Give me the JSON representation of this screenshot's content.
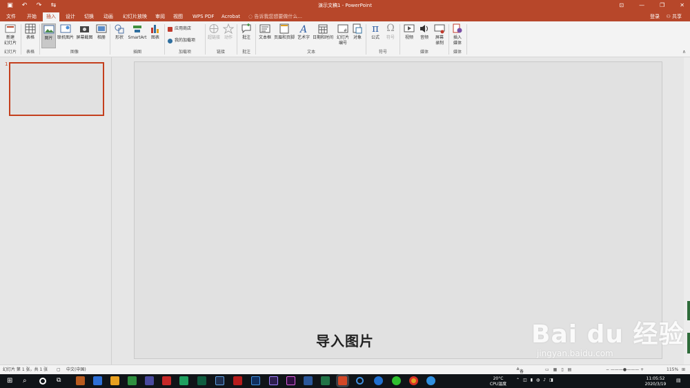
{
  "window": {
    "title": "演示文稿1 - PowerPoint",
    "qat": [
      "save-icon",
      "undo-icon",
      "redo-icon",
      "start-slideshow-icon"
    ],
    "qat_glyphs": [
      "▣",
      "↶",
      "↷",
      "⇆"
    ],
    "controls": [
      "ribbon-display-icon",
      "minimize-icon",
      "restore-icon",
      "close-icon"
    ],
    "control_glyphs": [
      "⊡",
      "—",
      "❐",
      "✕"
    ]
  },
  "menu": {
    "tabs": [
      "文件",
      "开始",
      "插入",
      "设计",
      "切换",
      "动画",
      "幻灯片放映",
      "审阅",
      "视图",
      "WPS PDF",
      "Acrobat"
    ],
    "active_tab": "插入",
    "tell_me": "告诉我您想要做什么...",
    "sign_in": "登录",
    "share": "共享"
  },
  "ribbon": {
    "buttons": {
      "new_slide": "新建\n幻灯片",
      "table": "表格",
      "pictures": "图片",
      "online_pictures": "联机图片",
      "screenshot": "屏幕截图",
      "album": "相册",
      "shapes": "形状",
      "smartart": "SmartArt",
      "chart": "图表",
      "store": "应用商店",
      "my_addins": "我的加载项",
      "hyperlink": "超链接",
      "action": "动作",
      "comment": "批注",
      "textbox": "文本框",
      "header_footer": "页眉和页脚",
      "wordart": "艺术字",
      "date_time": "日期和时间",
      "slide_number": "幻灯片\n编号",
      "object": "对象",
      "equation": "公式",
      "symbol": "符号",
      "video": "视频",
      "audio": "音频",
      "screen_recording": "屏幕\n录制",
      "insert_media": "插入\n媒体"
    },
    "groups": {
      "slides": "幻灯片",
      "tables": "表格",
      "images": "图像",
      "illustrations": "插图",
      "addins": "加载项",
      "links": "链接",
      "comments": "批注",
      "text": "文本",
      "symbols": "符号",
      "media": "媒体",
      "media2": "媒体"
    }
  },
  "thumbnails": {
    "slide_number": "1"
  },
  "slide": {
    "caption": "导入图片"
  },
  "status": {
    "slide_info": "幻灯片 第 1 张，共 1 张",
    "language": "中文(中国)",
    "notes": "备注",
    "zoom": "115%"
  },
  "taskbar": {
    "weather": "20°C",
    "cpu": "CPU温度",
    "time": "11:05:52",
    "date": "2020/3/19"
  },
  "watermark": {
    "brand": "Bai du 经验",
    "url": "jingyan.baidu.com"
  },
  "colors": {
    "accent": "#b7472a",
    "selection": "#c43e1c",
    "taskbar": "#101418"
  }
}
